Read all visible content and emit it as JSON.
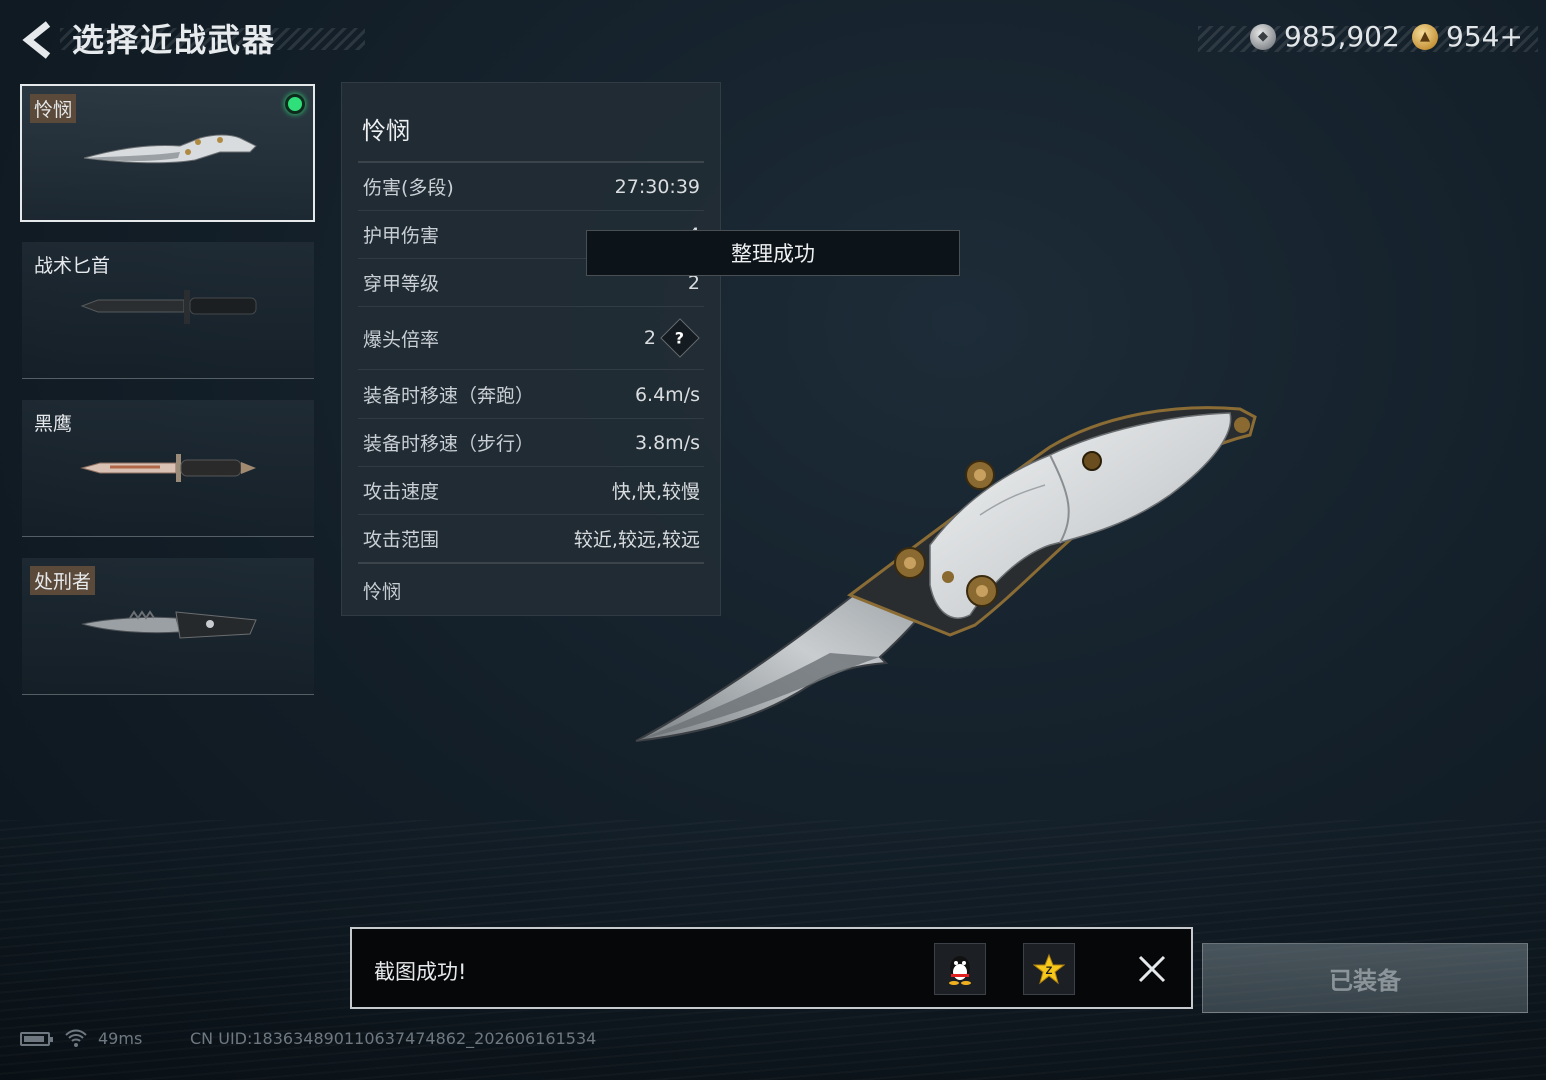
{
  "header": {
    "title": "选择近战武器"
  },
  "currency": {
    "silver": "985,902",
    "gold": "954+"
  },
  "weapons": [
    {
      "name": "怜悯",
      "selected": true,
      "equipped": true
    },
    {
      "name": "战术匕首",
      "selected": false,
      "equipped": false
    },
    {
      "name": "黑鹰",
      "selected": false,
      "equipped": false
    },
    {
      "name": "处刑者",
      "selected": false,
      "equipped": false
    }
  ],
  "stats": {
    "title": "怜悯",
    "rows": [
      {
        "label": "伤害(多段)",
        "value": "27:30:39"
      },
      {
        "label": "护甲伤害",
        "value": "4"
      },
      {
        "label": "穿甲等级",
        "value": "2"
      },
      {
        "label": "爆头倍率",
        "value": "2"
      },
      {
        "label": "装备时移速（奔跑）",
        "value": "6.4m/s"
      },
      {
        "label": "装备时移速（步行）",
        "value": "3.8m/s"
      },
      {
        "label": "攻击速度",
        "value": "快,快,较慢"
      },
      {
        "label": "攻击范围",
        "value": "较近,较远,较远"
      }
    ],
    "description": "怜悯",
    "help_symbol": "?"
  },
  "toast": {
    "text": "整理成功"
  },
  "screenshot": {
    "text": "截图成功!"
  },
  "equip_button": {
    "label": "已装备"
  },
  "status": {
    "ping": "49ms",
    "uid": "CN UID:183634890110637474862_202606161534"
  }
}
